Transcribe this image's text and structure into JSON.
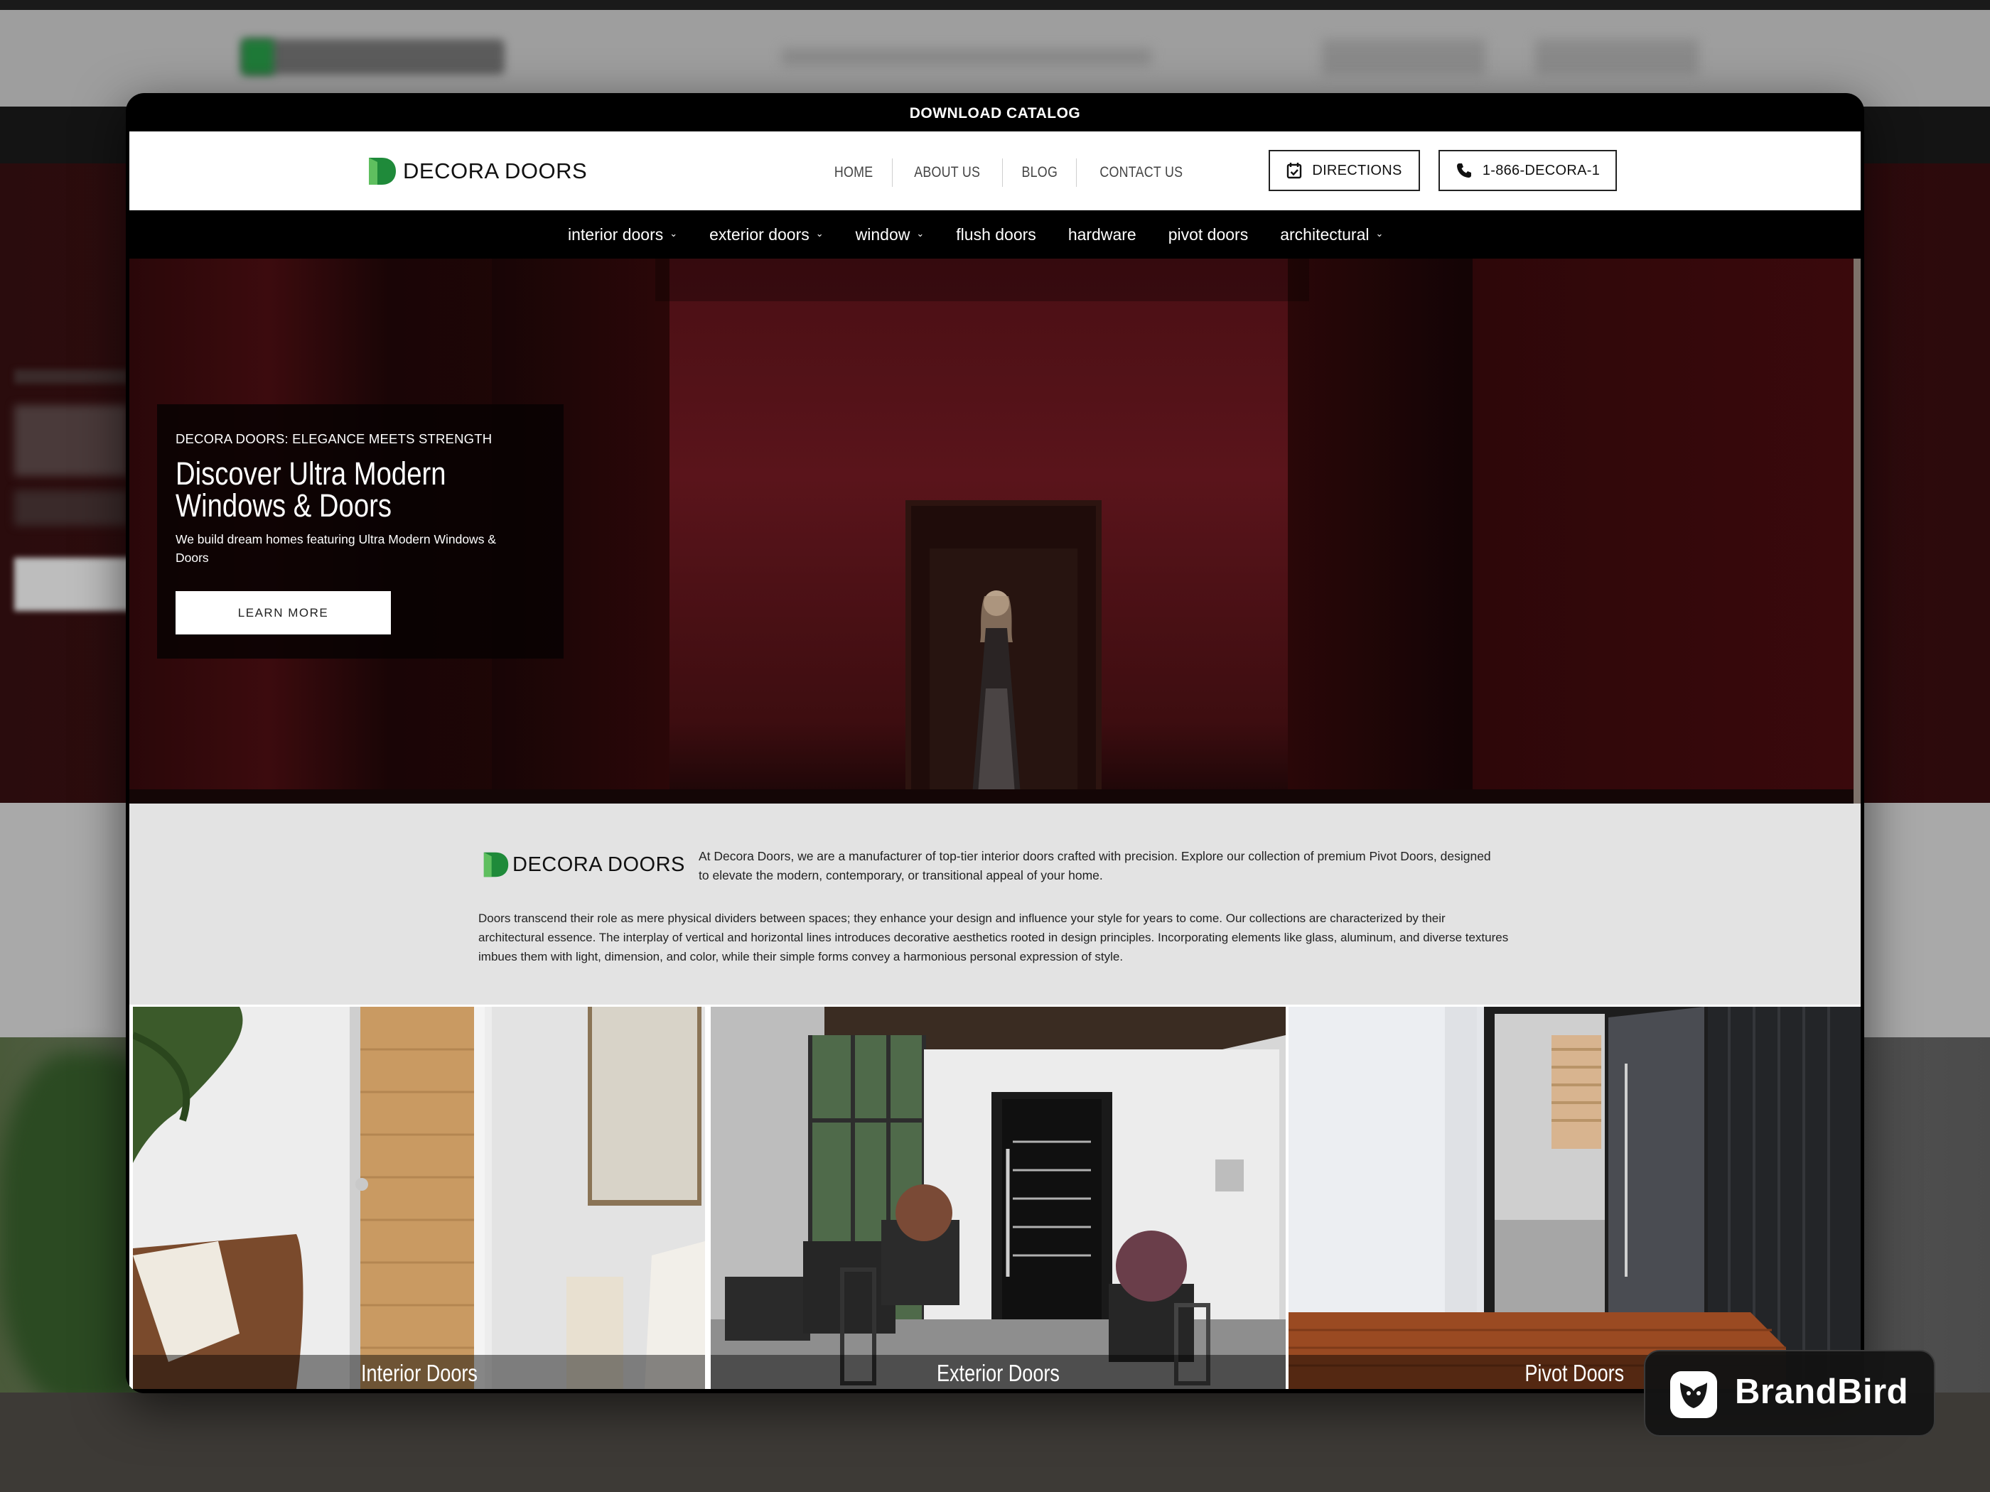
{
  "catalog_bar": {
    "label": "DOWNLOAD CATALOG"
  },
  "brand": {
    "name": "DECORA DOORS",
    "accent": "#1f8a3a"
  },
  "header": {
    "nav": [
      "HOME",
      "ABOUT US",
      "BLOG",
      "CONTACT US"
    ],
    "directions_label": "DIRECTIONS",
    "phone_label": "1-866-DECORA-1"
  },
  "category_nav": {
    "items": [
      {
        "label": "interior doors",
        "has_dropdown": true
      },
      {
        "label": "exterior doors",
        "has_dropdown": true
      },
      {
        "label": "window",
        "has_dropdown": true
      },
      {
        "label": "flush doors",
        "has_dropdown": false
      },
      {
        "label": "hardware",
        "has_dropdown": false
      },
      {
        "label": "pivot doors",
        "has_dropdown": false
      },
      {
        "label": "architectural",
        "has_dropdown": true
      }
    ],
    "dropdown_glyph": "⌄"
  },
  "hero": {
    "kicker": "DECORA DOORS: ELEGANCE MEETS STRENGTH",
    "title_line1": "Discover Ultra Modern",
    "title_line2": "Windows & Doors",
    "subtitle": "We build dream homes featuring Ultra Modern Windows & Doors",
    "cta_label": "LEARN MORE"
  },
  "about": {
    "intro": "At Decora Doors, we are a manufacturer of top-tier interior doors crafted with precision. Explore our collection of premium Pivot Doors, designed to elevate the modern, contemporary, or transitional appeal of your home.",
    "body": "Doors transcend their role as mere physical dividers between spaces; they enhance your design and influence your style for years to come. Our collections are characterized by their architectural essence. The interplay of vertical and horizontal lines introduces decorative aesthetics rooted in design principles. Incorporating elements like glass, aluminum, and diverse textures imbues them with light, dimension, and color, while their simple forms convey a harmonious personal expression of style."
  },
  "categories": [
    {
      "label": "Interior Doors"
    },
    {
      "label": "Exterior Doors"
    },
    {
      "label": "Pivot Doors"
    }
  ],
  "badge": {
    "label": "BrandBird"
  }
}
